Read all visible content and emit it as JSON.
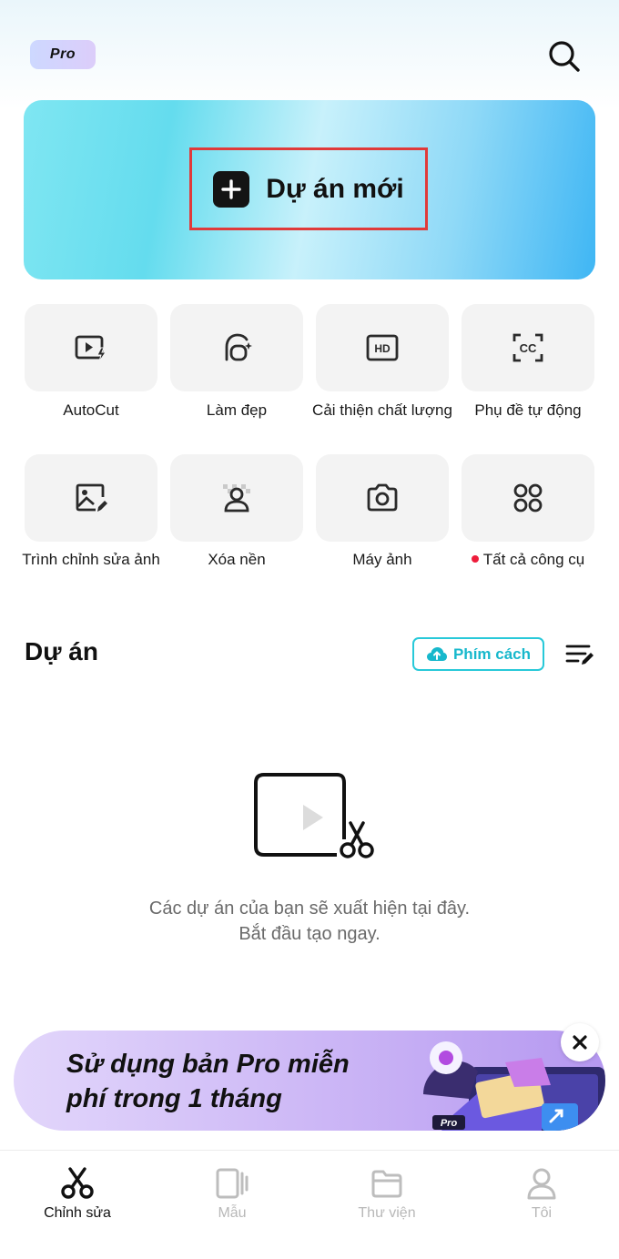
{
  "header": {
    "pro_label": "Pro",
    "search_icon": "search-icon"
  },
  "hero": {
    "new_project_label": "Dự án mới",
    "icon": "plus-icon"
  },
  "tools": [
    {
      "label": "AutoCut",
      "icon": "autocut-icon"
    },
    {
      "label": "Làm đẹp",
      "icon": "face-retouch-icon"
    },
    {
      "label": "Cải thiện chất lượng",
      "icon": "hd-icon"
    },
    {
      "label": "Phụ đề tự động",
      "icon": "caption-icon"
    },
    {
      "label": "Trình chỉnh sửa ảnh",
      "icon": "photo-edit-icon"
    },
    {
      "label": "Xóa nền",
      "icon": "remove-background-icon"
    },
    {
      "label": "Máy ảnh",
      "icon": "camera-icon"
    },
    {
      "label": "Tất cả công cụ",
      "icon": "all-tools-icon",
      "has_dot": true
    }
  ],
  "projects": {
    "title": "Dự án",
    "shortcut_label": "Phím cách",
    "empty_line1": "Các dự án của bạn sẽ xuất hiện tại đây.",
    "empty_line2": "Bắt đầu tạo ngay."
  },
  "promo": {
    "line1": "Sử dụng bản Pro miễn",
    "line2": "phí trong 1 tháng",
    "art_badge": "Pro"
  },
  "tabs": [
    {
      "label": "Chỉnh sửa",
      "icon": "scissors-icon",
      "active": true
    },
    {
      "label": "Mẫu",
      "icon": "template-icon",
      "active": false
    },
    {
      "label": "Thư viện",
      "icon": "folder-icon",
      "active": false
    },
    {
      "label": "Tôi",
      "icon": "profile-icon",
      "active": false
    }
  ],
  "colors": {
    "accent": "#28c9d9",
    "highlight_border": "#e03a3a",
    "notification_dot": "#ee1c3b"
  }
}
